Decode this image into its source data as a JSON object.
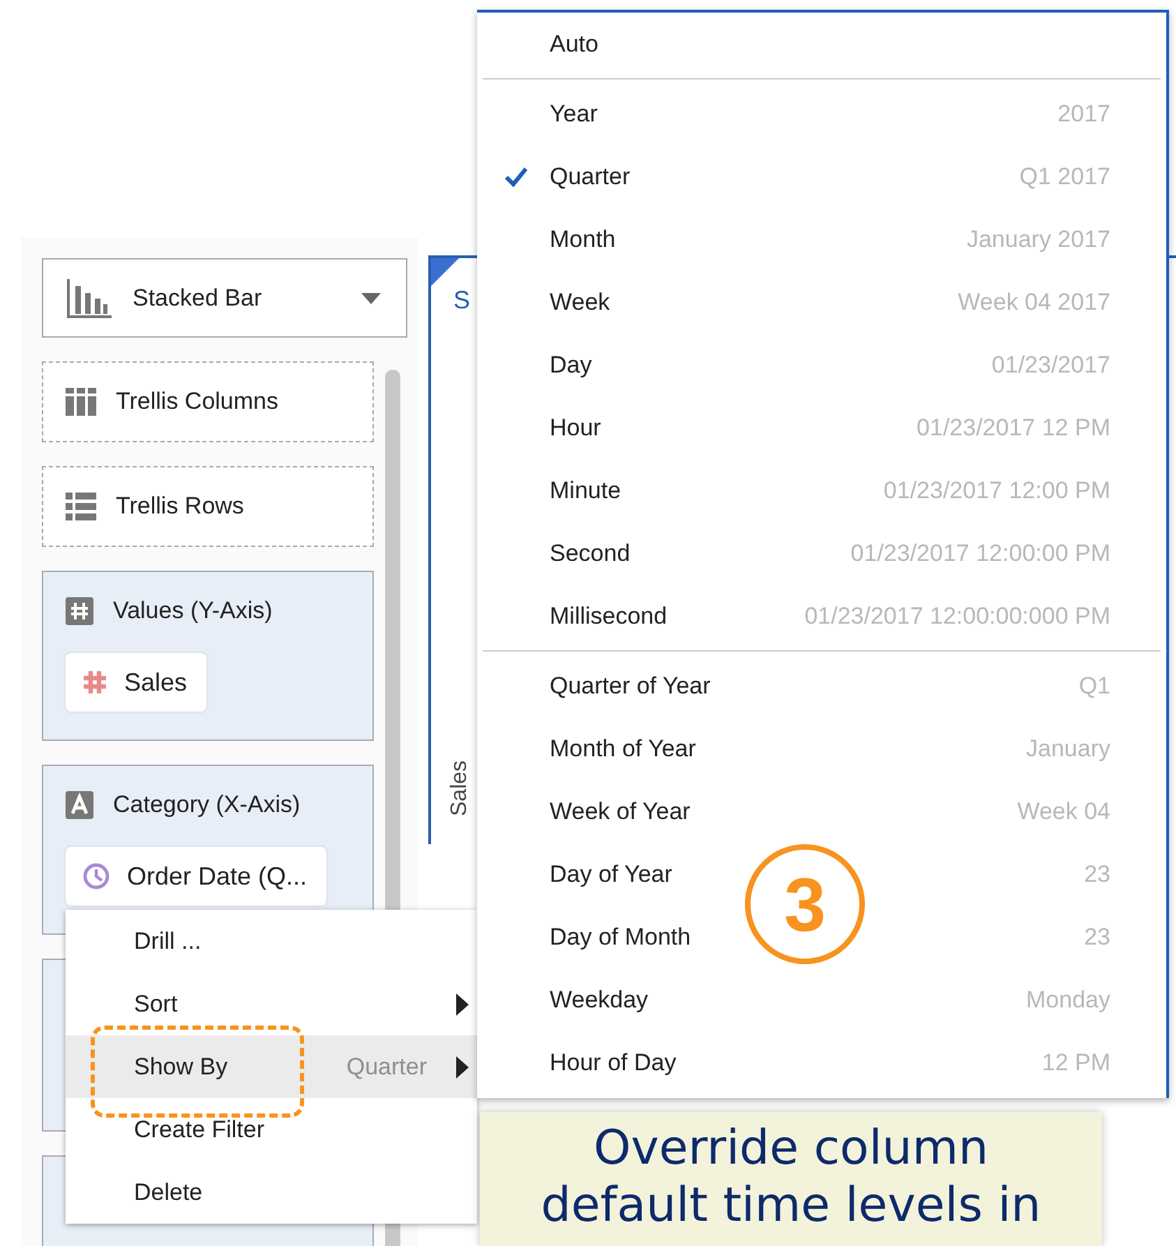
{
  "chart_type_select": {
    "label": "Stacked Bar"
  },
  "drop_zones": [
    {
      "kind": "trellis-columns",
      "label": "Trellis Columns"
    },
    {
      "kind": "trellis-rows",
      "label": "Trellis Rows"
    },
    {
      "kind": "values",
      "label": "Values (Y-Axis)",
      "pill": {
        "kind": "number",
        "label": "Sales"
      }
    },
    {
      "kind": "category",
      "label": "Category (X-Axis)",
      "pill": {
        "kind": "date",
        "label": "Order Date (Q..."
      }
    }
  ],
  "chart": {
    "title": "S",
    "axis_label": "Sales"
  },
  "context_menu": {
    "items": [
      {
        "label": "Drill ...",
        "submenu": false,
        "selected": false
      },
      {
        "label": "Sort",
        "submenu": true,
        "selected": false
      },
      {
        "label": "Show By",
        "value": "Quarter",
        "submenu": true,
        "selected": true
      },
      {
        "label": "Create Filter",
        "submenu": false,
        "selected": false
      },
      {
        "label": "Delete",
        "submenu": false,
        "selected": false
      }
    ]
  },
  "time_menu": {
    "groups": [
      [
        {
          "label": "Auto",
          "checked": false
        }
      ],
      [
        {
          "label": "Year",
          "example": "2017",
          "checked": false
        },
        {
          "label": "Quarter",
          "example": "Q1 2017",
          "checked": true
        },
        {
          "label": "Month",
          "example": "January 2017",
          "checked": false
        },
        {
          "label": "Week",
          "example": "Week 04 2017",
          "checked": false
        },
        {
          "label": "Day",
          "example": "01/23/2017",
          "checked": false
        },
        {
          "label": "Hour",
          "example": "01/23/2017 12 PM",
          "checked": false
        },
        {
          "label": "Minute",
          "example": "01/23/2017 12:00 PM",
          "checked": false
        },
        {
          "label": "Second",
          "example": "01/23/2017 12:00:00 PM",
          "checked": false
        },
        {
          "label": "Millisecond",
          "example": "01/23/2017 12:00:00:000 PM",
          "checked": false
        }
      ],
      [
        {
          "label": "Quarter of Year",
          "example": "Q1",
          "checked": false
        },
        {
          "label": "Month of Year",
          "example": "January",
          "checked": false
        },
        {
          "label": "Week of Year",
          "example": "Week 04",
          "checked": false
        },
        {
          "label": "Day of Year",
          "example": "23",
          "checked": false
        },
        {
          "label": "Day of Month",
          "example": "23",
          "checked": false
        },
        {
          "label": "Weekday",
          "example": "Monday",
          "checked": false
        },
        {
          "label": "Hour of Day",
          "example": "12 PM",
          "checked": false
        }
      ]
    ]
  },
  "annotation": {
    "step": "3",
    "callout": "Override column default time levels in"
  }
}
